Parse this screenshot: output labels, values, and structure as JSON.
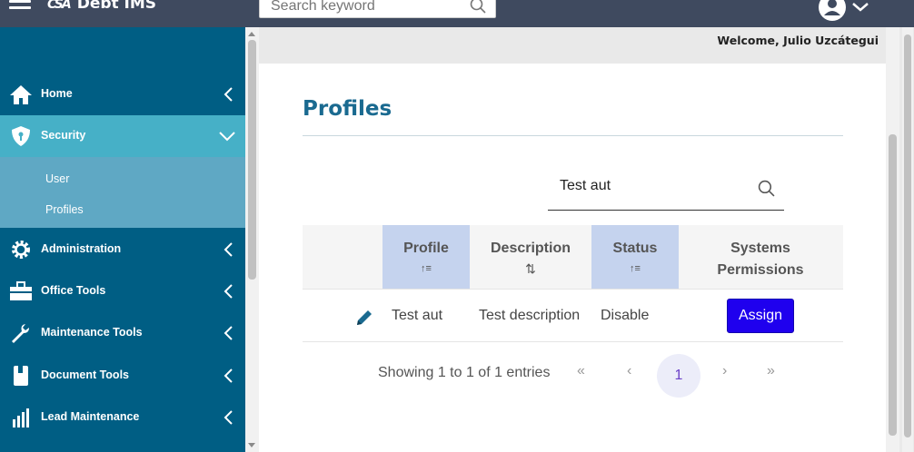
{
  "header": {
    "app_logo_mark": "CSA",
    "app_title": "Debt IMS",
    "search_placeholder": "Search keyword"
  },
  "welcome_text": "Welcome, Julio Uzcátegui",
  "sidebar": {
    "items": [
      {
        "label": "Home",
        "icon": "home-icon"
      },
      {
        "label": "Security",
        "icon": "shield-icon",
        "expanded": true
      },
      {
        "label": "Administration",
        "icon": "gear-icon"
      },
      {
        "label": "Office Tools",
        "icon": "toolbox-icon"
      },
      {
        "label": "Maintenance Tools",
        "icon": "wrench-icon"
      },
      {
        "label": "Document Tools",
        "icon": "book-icon"
      },
      {
        "label": "Lead Maintenance",
        "icon": "chart-icon"
      }
    ],
    "security_subitems": [
      "User",
      "Profiles"
    ]
  },
  "page": {
    "title": "Profiles",
    "filter_value": "Test aut"
  },
  "table": {
    "columns": [
      "Profile",
      "Description",
      "Status",
      "Systems Permissions"
    ],
    "sort_indicators": {
      "profile": "↑≡",
      "description": "⇅",
      "status": "↑≡"
    },
    "rows": [
      {
        "profile": "Test aut",
        "description": "Test description",
        "status": "Disable",
        "action": "Assign"
      }
    ]
  },
  "pagination": {
    "showing": "Showing 1 to 1 of 1 entries",
    "first": "«",
    "prev": "‹",
    "current": "1",
    "next": "›",
    "last": "»"
  },
  "colors": {
    "topbar": "#3f4a5f",
    "sidebar": "#005e84",
    "sidebar_active": "#46b0c7",
    "submenu": "#5fa8c4",
    "title": "#1a6a90",
    "assign_button": "#1f00ee",
    "sorted_header": "#c5d3ee"
  }
}
